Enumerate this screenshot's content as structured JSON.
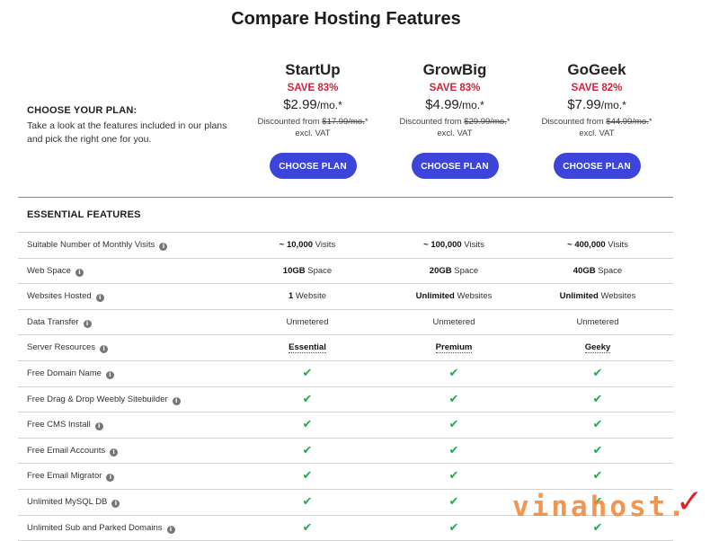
{
  "title": "Compare Hosting Features",
  "intro": {
    "heading": "CHOOSE YOUR PLAN:",
    "description": "Take a look at the features included in our plans and pick the right one for you."
  },
  "plans": [
    {
      "name": "StartUp",
      "save": "SAVE 83%",
      "price": "$2.99",
      "unit": "/mo.*",
      "discount_prefix": "Discounted from",
      "old_price": "$17.99/mo.",
      "old_suffix": "*",
      "vat": "excl. VAT",
      "button": "CHOOSE PLAN"
    },
    {
      "name": "GrowBig",
      "save": "SAVE 83%",
      "price": "$4.99",
      "unit": "/mo.*",
      "discount_prefix": "Discounted from",
      "old_price": "$29.99/mo.",
      "old_suffix": "*",
      "vat": "excl. VAT",
      "button": "CHOOSE PLAN"
    },
    {
      "name": "GoGeek",
      "save": "SAVE 82%",
      "price": "$7.99",
      "unit": "/mo.*",
      "discount_prefix": "Discounted from",
      "old_price": "$44.99/mo.",
      "old_suffix": "*",
      "vat": "excl. VAT",
      "button": "CHOOSE PLAN"
    }
  ],
  "section": "ESSENTIAL FEATURES",
  "rows": [
    {
      "label": "Suitable Number of Monthly Visits",
      "cells": [
        [
          "~ 10,000",
          " Visits"
        ],
        [
          "~ 100,000",
          " Visits"
        ],
        [
          "~ 400,000",
          " Visits"
        ]
      ]
    },
    {
      "label": "Web Space",
      "cells": [
        [
          "10GB",
          " Space"
        ],
        [
          "20GB",
          " Space"
        ],
        [
          "40GB",
          " Space"
        ]
      ]
    },
    {
      "label": "Websites Hosted",
      "cells": [
        [
          "1",
          " Website"
        ],
        [
          "Unlimited",
          " Websites"
        ],
        [
          "Unlimited",
          " Websites"
        ]
      ]
    },
    {
      "label": "Data Transfer",
      "cells": [
        [
          "",
          "Unmetered"
        ],
        [
          "",
          "Unmetered"
        ],
        [
          "",
          "Unmetered"
        ]
      ]
    },
    {
      "label": "Server Resources",
      "cells": [
        [
          "Essential",
          ""
        ],
        [
          "Premium",
          ""
        ],
        [
          "Geeky",
          ""
        ]
      ],
      "tier": true
    },
    {
      "label": "Free Domain Name",
      "check": true
    },
    {
      "label": "Free Drag & Drop Weebly Sitebuilder",
      "check": true
    },
    {
      "label": "Free CMS Install",
      "check": true
    },
    {
      "label": "Free Email Accounts",
      "check": true
    },
    {
      "label": "Free Email Migrator",
      "check": true
    },
    {
      "label": "Unlimited MySQL DB",
      "check": true
    },
    {
      "label": "Unlimited Sub and Parked Domains",
      "check": true
    }
  ],
  "icons": {
    "info": "info-icon",
    "check": "check-icon"
  },
  "check_glyph": "✔",
  "info_glyph": "i",
  "watermark": "vinahost.",
  "colors": {
    "accent": "#3d44d9",
    "save": "#d4213d",
    "check": "#1eae4b"
  }
}
